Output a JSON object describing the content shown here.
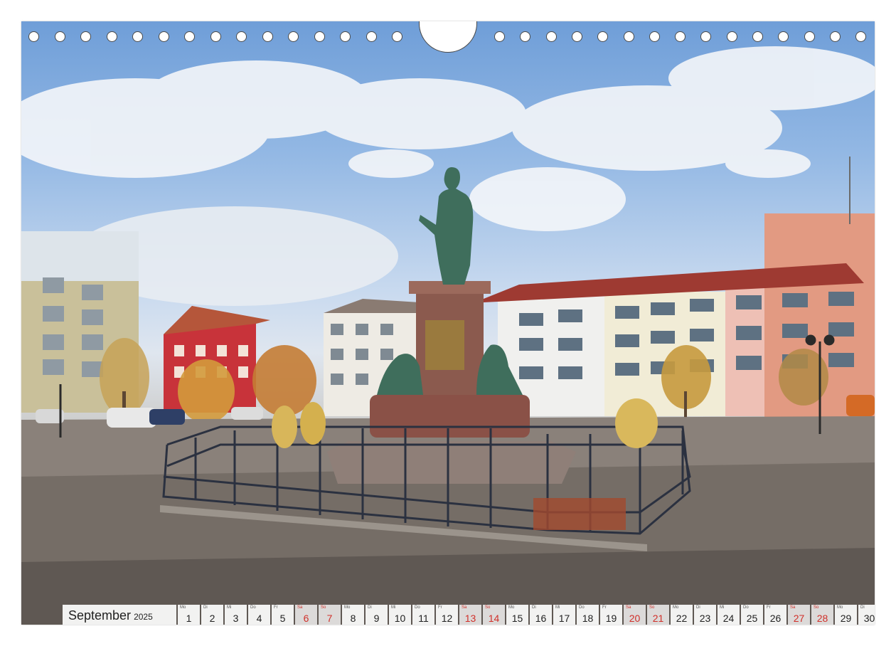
{
  "calendar": {
    "month": "September",
    "year": "2025",
    "days": [
      {
        "wd": "Mo",
        "d": "1",
        "we": false
      },
      {
        "wd": "Di",
        "d": "2",
        "we": false
      },
      {
        "wd": "Mi",
        "d": "3",
        "we": false
      },
      {
        "wd": "Do",
        "d": "4",
        "we": false
      },
      {
        "wd": "Fr",
        "d": "5",
        "we": false
      },
      {
        "wd": "Sa",
        "d": "6",
        "we": true
      },
      {
        "wd": "So",
        "d": "7",
        "we": true
      },
      {
        "wd": "Mo",
        "d": "8",
        "we": false
      },
      {
        "wd": "Di",
        "d": "9",
        "we": false
      },
      {
        "wd": "Mi",
        "d": "10",
        "we": false
      },
      {
        "wd": "Do",
        "d": "11",
        "we": false
      },
      {
        "wd": "Fr",
        "d": "12",
        "we": false
      },
      {
        "wd": "Sa",
        "d": "13",
        "we": true
      },
      {
        "wd": "So",
        "d": "14",
        "we": true
      },
      {
        "wd": "Mo",
        "d": "15",
        "we": false
      },
      {
        "wd": "Di",
        "d": "16",
        "we": false
      },
      {
        "wd": "Mi",
        "d": "17",
        "we": false
      },
      {
        "wd": "Do",
        "d": "18",
        "we": false
      },
      {
        "wd": "Fr",
        "d": "19",
        "we": false
      },
      {
        "wd": "Sa",
        "d": "20",
        "we": true
      },
      {
        "wd": "So",
        "d": "21",
        "we": true
      },
      {
        "wd": "Mo",
        "d": "22",
        "we": false
      },
      {
        "wd": "Di",
        "d": "23",
        "we": false
      },
      {
        "wd": "Mi",
        "d": "24",
        "we": false
      },
      {
        "wd": "Do",
        "d": "25",
        "we": false
      },
      {
        "wd": "Fr",
        "d": "26",
        "we": false
      },
      {
        "wd": "Sa",
        "d": "27",
        "we": true
      },
      {
        "wd": "So",
        "d": "28",
        "we": true
      },
      {
        "wd": "Mo",
        "d": "29",
        "we": false
      },
      {
        "wd": "Di",
        "d": "30",
        "we": false
      }
    ]
  },
  "colors": {
    "weekend": "#d0302a",
    "sky": "#7aa6dc",
    "pavement": "#7d756e",
    "bronze": "#3f6e5c"
  }
}
